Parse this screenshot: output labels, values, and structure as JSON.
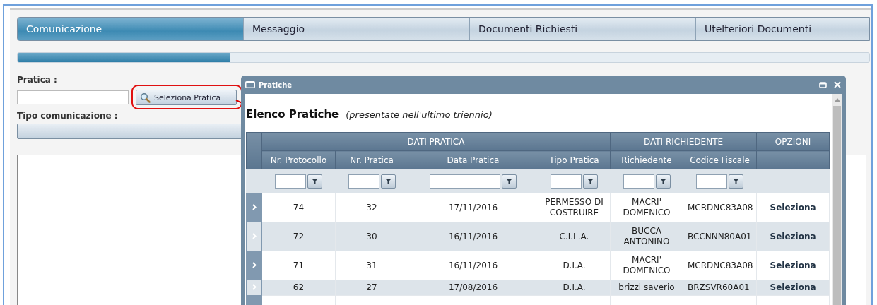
{
  "steps": [
    {
      "label": "Comunicazione",
      "selected": true
    },
    {
      "label": "Messaggio",
      "selected": false
    },
    {
      "label": "Documenti Richiesti",
      "selected": false
    },
    {
      "label": "Utelteriori Documenti",
      "selected": false
    }
  ],
  "progress": {
    "level": 0.25
  },
  "form": {
    "pratica_label": "Pratica :",
    "select_button": "Seleziona Pratica",
    "tipo_label": "Tipo comunicazione :"
  },
  "dialog": {
    "title": "Pratiche",
    "heading": "Elenco Pratiche",
    "subheading": "(presentate nell'ultimo triennio)",
    "groups": [
      "DATI PRATICA",
      "DATI RICHIEDENTE",
      "OPZIONI"
    ],
    "columns": [
      "Nr. Protocollo",
      "Nr. Pratica",
      "Data Pratica",
      "Tipo Pratica",
      "Richiedente",
      "Codice Fiscale"
    ],
    "rows": [
      {
        "cells": [
          "74",
          "32",
          "17/11/2016",
          "PERMESSO DI COSTRUIRE",
          "MACRI' DOMENICO",
          "MCRDNC83A08"
        ],
        "action": "Seleziona"
      },
      {
        "cells": [
          "72",
          "30",
          "16/11/2016",
          "C.I.L.A.",
          "BUCCA ANTONINO",
          "BCCNNN80A01"
        ],
        "action": "Seleziona"
      },
      {
        "cells": [
          "71",
          "31",
          "16/11/2016",
          "D.I.A.",
          "MACRI' DOMENICO",
          "MCRDNC83A08"
        ],
        "action": "Seleziona"
      },
      {
        "cells": [
          "62",
          "27",
          "17/08/2016",
          "D.I.A.",
          "brizzi saverio",
          "BRZSVR60A01"
        ],
        "action": "Seleziona"
      }
    ]
  }
}
